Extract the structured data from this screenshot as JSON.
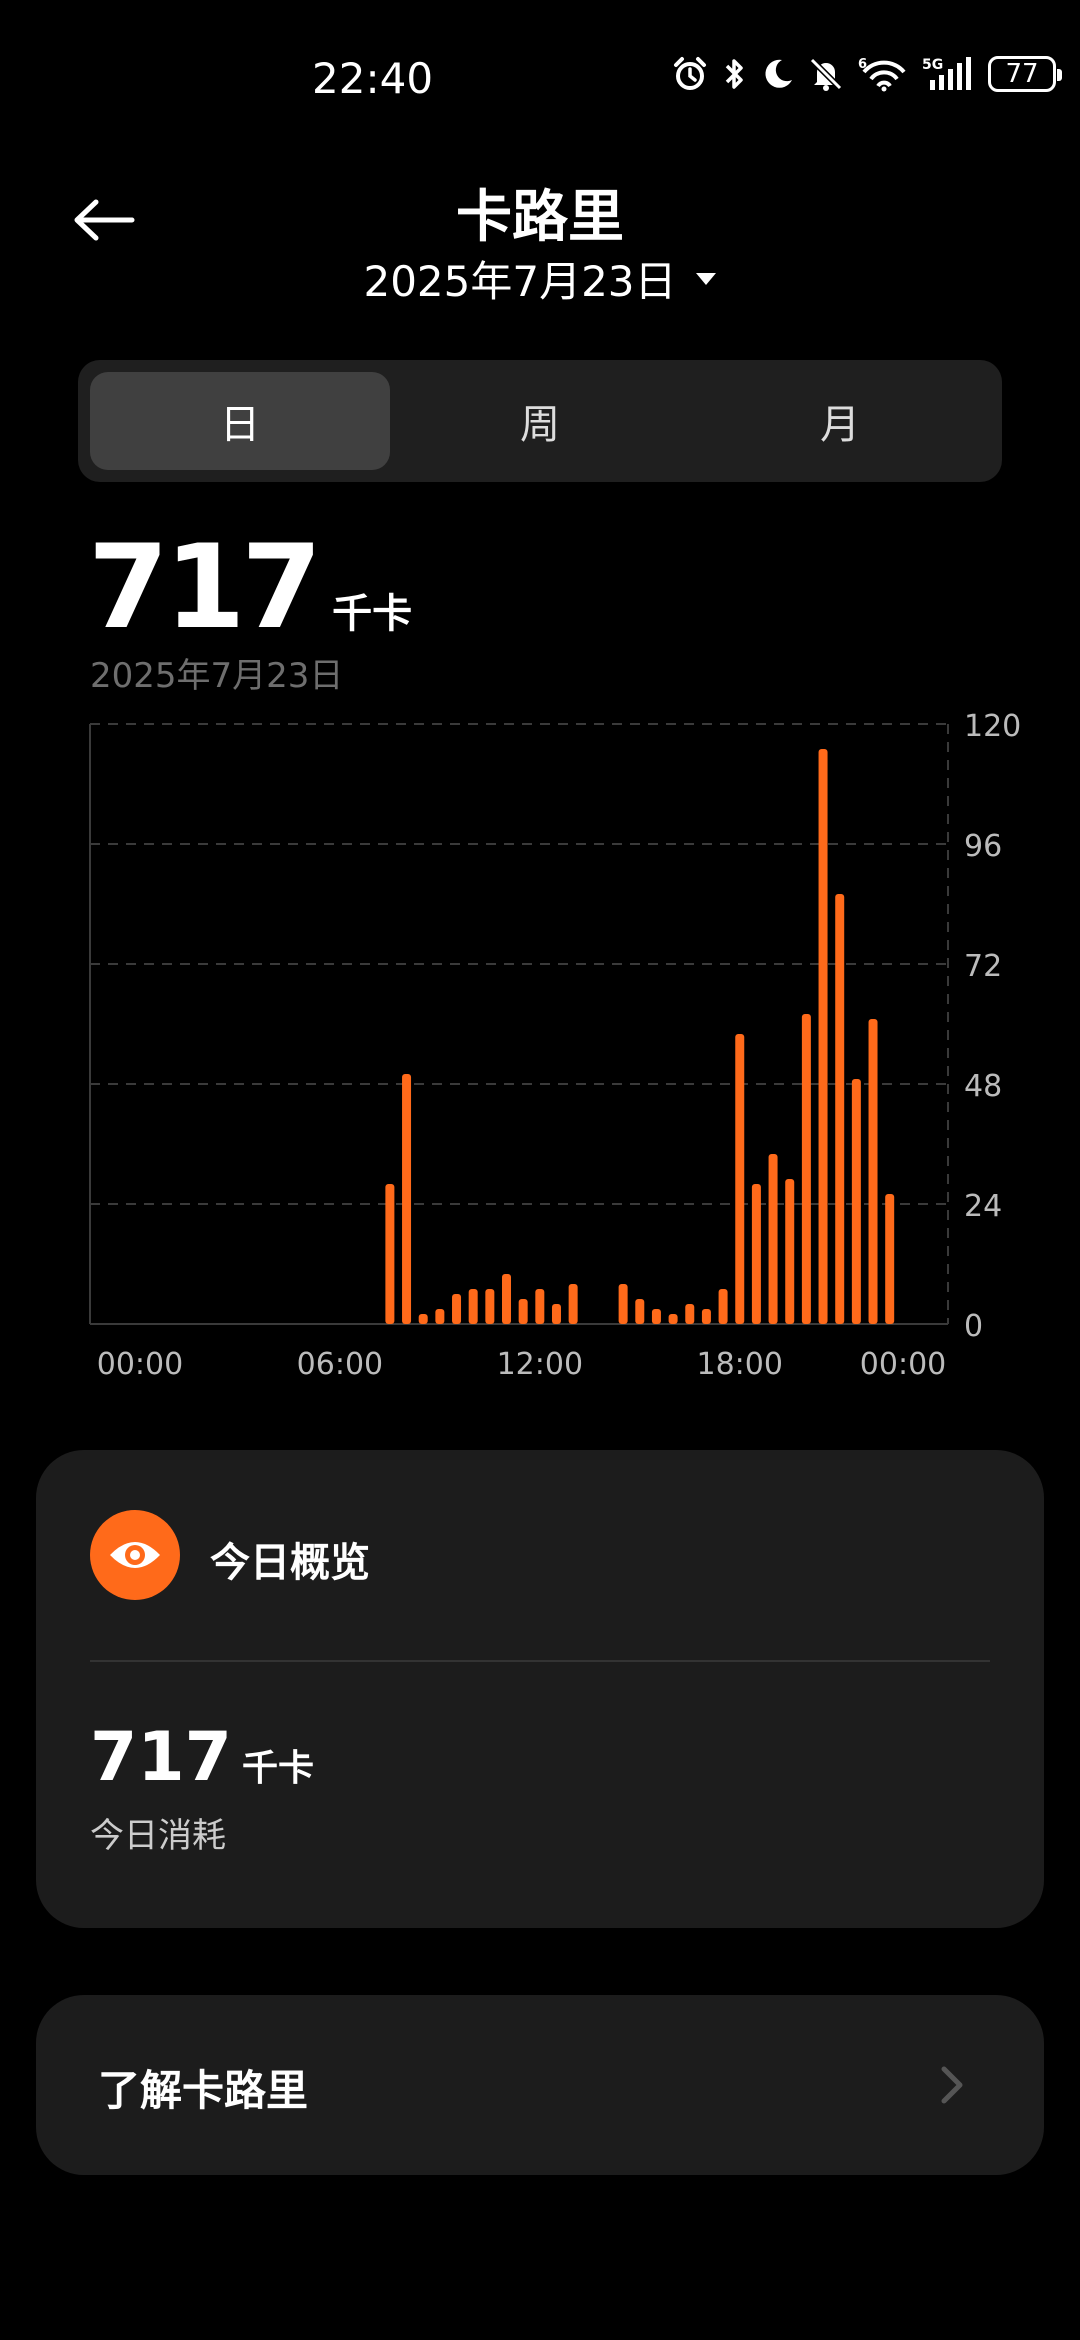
{
  "status_bar": {
    "time": "22:40",
    "icons": [
      "alarm-icon",
      "bluetooth-icon",
      "moon-icon",
      "mute-icon",
      "wifi-6-icon",
      "signal-5g-icon"
    ],
    "battery": "77"
  },
  "header": {
    "title": "卡路里",
    "date": "2025年7月23日",
    "back_icon": "arrow-left-icon",
    "dropdown_icon": "triangle-down-icon"
  },
  "tabs": [
    {
      "label": "日",
      "active": true
    },
    {
      "label": "周",
      "active": false
    },
    {
      "label": "月",
      "active": false
    }
  ],
  "summary": {
    "value": "717",
    "unit": "千卡",
    "date": "2025年7月23日"
  },
  "chart_data": {
    "type": "bar",
    "x_tick_labels": [
      "00:00",
      "06:00",
      "12:00",
      "18:00",
      "00:00"
    ],
    "y_tick_labels": [
      "120",
      "96",
      "72",
      "48",
      "24",
      "0"
    ],
    "ylim": [
      0,
      120
    ],
    "y_ticks": [
      0,
      24,
      48,
      72,
      96,
      120
    ],
    "grid": true,
    "bar_color": "#ff6a1a",
    "x_unit": "hour",
    "xlim": [
      -1.5,
      24.25
    ],
    "x": [
      7.5,
      8.0,
      8.5,
      9.0,
      9.5,
      10.0,
      10.5,
      11.0,
      11.5,
      12.0,
      12.5,
      13.0,
      13.5,
      14.5,
      15.0,
      15.5,
      16.0,
      16.5,
      17.0,
      17.5,
      18.0,
      18.5,
      19.0,
      19.5,
      20.0,
      20.5,
      21.0,
      21.5,
      22.0,
      22.5
    ],
    "values": [
      28,
      50,
      2,
      3,
      6,
      7,
      7,
      10,
      5,
      7,
      4,
      8,
      0,
      8,
      5,
      3,
      2,
      4,
      3,
      7,
      58,
      28,
      34,
      29,
      62,
      115,
      86,
      49,
      61,
      26
    ]
  },
  "overview": {
    "icon": "eye-icon",
    "title": "今日概览",
    "value": "717",
    "unit": "千卡",
    "label": "今日消耗"
  },
  "learn": {
    "title": "了解卡路里",
    "icon": "chevron-right-icon"
  },
  "colors": {
    "accent": "#ff6a1a",
    "background": "#000000",
    "card": "#1c1c1c"
  }
}
